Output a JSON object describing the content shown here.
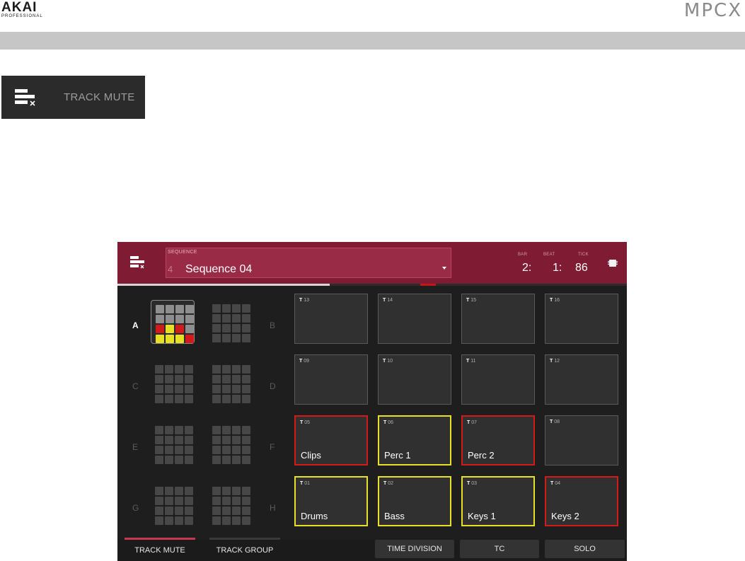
{
  "header": {
    "brand_main": "AKAI",
    "brand_sub": "PROFESSIONAL",
    "product": "MPCX"
  },
  "mode_badge": {
    "icon": "track-mute-icon",
    "label": "TRACK MUTE"
  },
  "screen": {
    "sequence": {
      "caption": "SEQUENCE",
      "number": "4",
      "name": "Sequence 04"
    },
    "position": {
      "bar_label": "BAR",
      "beat_label": "BEAT",
      "tick_label": "TICK",
      "bar": "2:",
      "beat": "1:",
      "tick": "86"
    },
    "banks": {
      "letters": [
        "A",
        "B",
        "C",
        "D",
        "E",
        "F",
        "G",
        "H"
      ],
      "active": "A"
    },
    "pads": [
      {
        "tnum": "13",
        "name": "",
        "state": "none"
      },
      {
        "tnum": "14",
        "name": "",
        "state": "none"
      },
      {
        "tnum": "15",
        "name": "",
        "state": "none"
      },
      {
        "tnum": "16",
        "name": "",
        "state": "none"
      },
      {
        "tnum": "09",
        "name": "",
        "state": "none"
      },
      {
        "tnum": "10",
        "name": "",
        "state": "none"
      },
      {
        "tnum": "11",
        "name": "",
        "state": "none"
      },
      {
        "tnum": "12",
        "name": "",
        "state": "none"
      },
      {
        "tnum": "05",
        "name": "Clips",
        "state": "red"
      },
      {
        "tnum": "06",
        "name": "Perc 1",
        "state": "yellow"
      },
      {
        "tnum": "07",
        "name": "Perc 2",
        "state": "red"
      },
      {
        "tnum": "08",
        "name": "",
        "state": "none"
      },
      {
        "tnum": "01",
        "name": "Drums",
        "state": "yellow"
      },
      {
        "tnum": "02",
        "name": "Bass",
        "state": "yellow"
      },
      {
        "tnum": "03",
        "name": "Keys 1",
        "state": "yellow"
      },
      {
        "tnum": "04",
        "name": "Keys 2",
        "state": "red"
      }
    ],
    "tab_prefix": "T",
    "bottom": {
      "tab_track_mute": "TRACK MUTE",
      "tab_track_group": "TRACK GROUP",
      "btn_time_division": "TIME DIVISION",
      "btn_tc": "TC",
      "btn_solo": "SOLO"
    }
  },
  "colors": {
    "header_red": "#7f1c33",
    "mute_red": "#d11a1a",
    "solo_yellow": "#e6e126"
  }
}
